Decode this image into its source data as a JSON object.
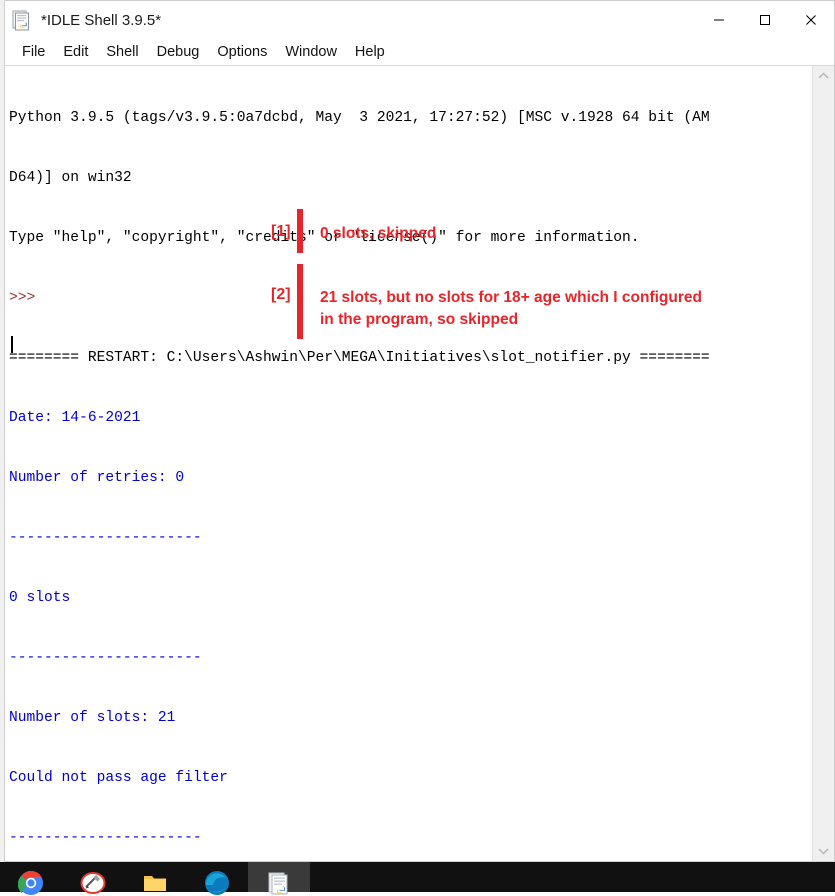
{
  "window": {
    "title": "*IDLE Shell 3.9.5*",
    "icon": "idle-python-document-icon",
    "controls": {
      "minimize": "minimize-icon",
      "maximize": "maximize-icon",
      "close": "close-icon"
    }
  },
  "menu": {
    "items": [
      {
        "label": "File"
      },
      {
        "label": "Edit"
      },
      {
        "label": "Shell"
      },
      {
        "label": "Debug"
      },
      {
        "label": "Options"
      },
      {
        "label": "Window"
      },
      {
        "label": "Help"
      }
    ]
  },
  "shell": {
    "lines": [
      {
        "text": "Python 3.9.5 (tags/v3.9.5:0a7dcbd, May  3 2021, 17:27:52) [MSC v.1928 64 bit (AM",
        "color": "black"
      },
      {
        "text": "D64)] on win32",
        "color": "black"
      },
      {
        "text": "Type \"help\", \"copyright\", \"credits\" or \"license()\" for more information.",
        "color": "black"
      },
      {
        "text": ">>>",
        "color": "prompt"
      },
      {
        "text": "======== RESTART: C:\\Users\\Ashwin\\Per\\MEGA\\Initiatives\\slot_notifier.py ========",
        "color": "black"
      },
      {
        "text": "Date: 14-6-2021",
        "color": "blue"
      },
      {
        "text": "Number of retries: 0",
        "color": "blue"
      },
      {
        "text": "----------------------",
        "color": "blue"
      },
      {
        "text": "0 slots",
        "color": "blue"
      },
      {
        "text": "----------------------",
        "color": "blue"
      },
      {
        "text": "Number of slots: 21",
        "color": "blue"
      },
      {
        "text": "Could not pass age filter",
        "color": "blue"
      },
      {
        "text": "----------------------",
        "color": "blue"
      }
    ]
  },
  "scrollbar": {
    "up_arrow": "chevron-up-icon",
    "down_arrow": "chevron-down-icon"
  },
  "annotations": {
    "accent_color": "#e8252b",
    "items": [
      {
        "tag": "[1]",
        "note": "0 slots, skipped"
      },
      {
        "tag": "[2]",
        "note": "21 slots, but no slots for 18+ age which I configured\nin the program, so skipped"
      }
    ]
  },
  "taskbar": {
    "items": [
      {
        "name": "chrome-icon"
      },
      {
        "name": "paint-icon"
      },
      {
        "name": "file-explorer-icon"
      },
      {
        "name": "edge-icon"
      },
      {
        "name": "idle-window-icon",
        "active": true
      }
    ]
  }
}
